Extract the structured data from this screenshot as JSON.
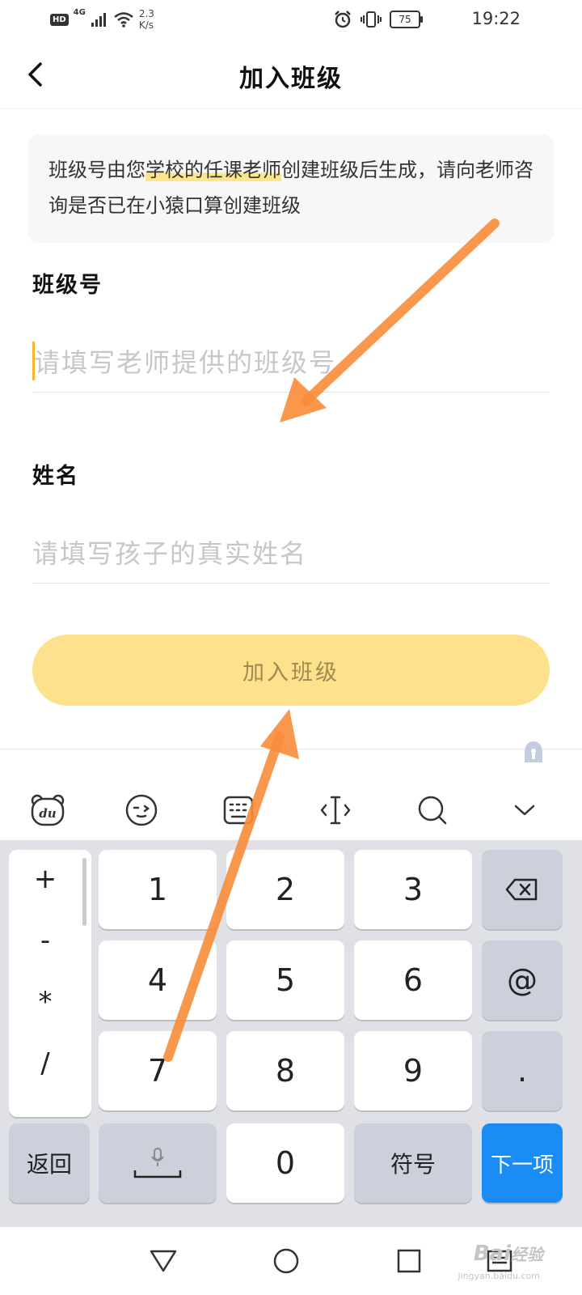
{
  "status_bar": {
    "network": "HD",
    "signal_type": "4G",
    "speed_value": "2.3",
    "speed_unit": "K/s",
    "battery": "75",
    "time": "19:22"
  },
  "header": {
    "title": "加入班级"
  },
  "info": {
    "text_before": "班级号由您",
    "text_highlight": "学校的任课老师",
    "text_after": "创建班级后生成，请向老师咨询是否已在小猿口算创建班级"
  },
  "form": {
    "class_label": "班级号",
    "class_placeholder": "请填写老师提供的班级号",
    "class_value": "",
    "name_label": "姓名",
    "name_placeholder": "请填写孩子的真实姓名",
    "name_value": ""
  },
  "join_button": "加入班级",
  "keyboard": {
    "toolbar_icons": [
      "baidu-bear-icon",
      "emoji-icon",
      "keyboard-icon",
      "cursor-move-icon",
      "search-icon",
      "collapse-icon"
    ],
    "symbols": [
      "+",
      "-",
      "*",
      "/"
    ],
    "digits": [
      "1",
      "2",
      "3",
      "4",
      "5",
      "6",
      "7",
      "8",
      "9",
      "0"
    ],
    "at": "@",
    "dot": ".",
    "back": "返回",
    "symbol_key": "符号",
    "next": "下一项"
  },
  "watermark": {
    "brand": "Bai",
    "brand_suffix": "经验",
    "sub": "jingyan.baidu.com"
  },
  "colors": {
    "accent_yellow": "#fde18d",
    "caret": "#f5b82b",
    "next_key": "#1a8cf5",
    "annotation_arrow": "#f98c3a"
  }
}
